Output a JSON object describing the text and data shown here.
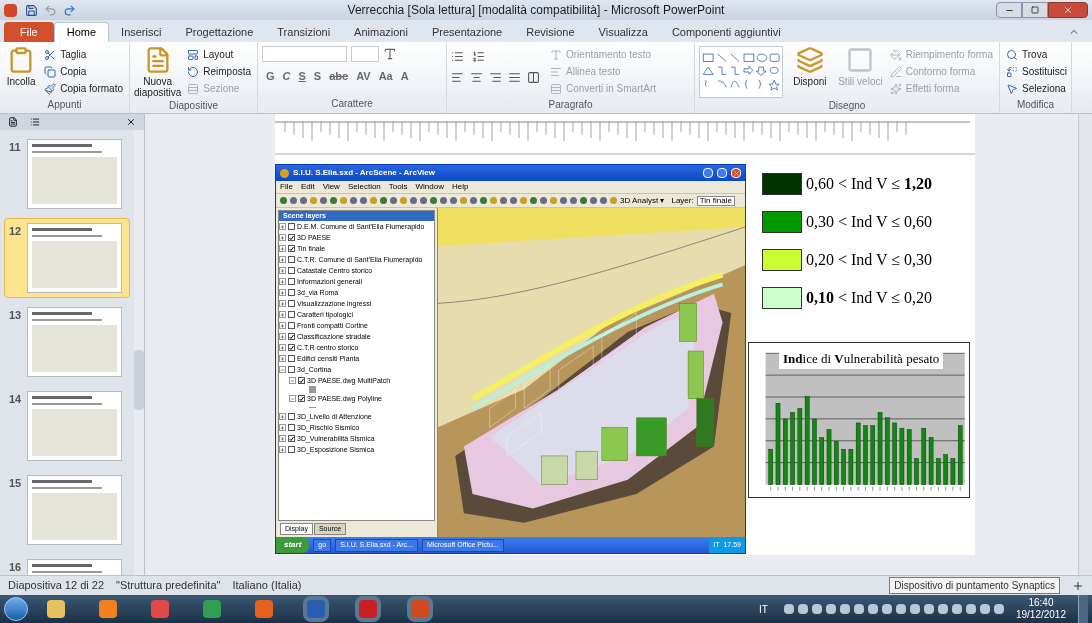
{
  "window": {
    "title": "Verrecchia [Sola lettura] [modalità compatibilità]  -  Microsoft PowerPoint"
  },
  "ribbon_tabs": [
    {
      "label": "File",
      "kind": "file",
      "selected": false
    },
    {
      "label": "Home",
      "kind": "tab",
      "selected": true
    },
    {
      "label": "Inserisci",
      "kind": "tab",
      "selected": false
    },
    {
      "label": "Progettazione",
      "kind": "tab",
      "selected": false
    },
    {
      "label": "Transizioni",
      "kind": "tab",
      "selected": false
    },
    {
      "label": "Animazioni",
      "kind": "tab",
      "selected": false
    },
    {
      "label": "Presentazione",
      "kind": "tab",
      "selected": false
    },
    {
      "label": "Revisione",
      "kind": "tab",
      "selected": false
    },
    {
      "label": "Visualizza",
      "kind": "tab",
      "selected": false
    },
    {
      "label": "Componenti aggiuntivi",
      "kind": "tab",
      "selected": false
    }
  ],
  "ribbon_groups": [
    {
      "label": "Appunti",
      "kind": "standard",
      "large": [
        {
          "label": "Incolla",
          "disabled": false
        }
      ],
      "small": [
        {
          "label": "Taglia",
          "disabled": false
        },
        {
          "label": "Copia",
          "disabled": false
        },
        {
          "label": "Copia formato",
          "disabled": false
        }
      ]
    },
    {
      "label": "Diapositive",
      "kind": "standard",
      "large": [
        {
          "label": "Nuova diapositiva",
          "disabled": false
        }
      ],
      "small": [
        {
          "label": "Layout",
          "disabled": false
        },
        {
          "label": "Reimposta",
          "disabled": false
        },
        {
          "label": "Sezione",
          "disabled": true
        }
      ]
    },
    {
      "label": "Carattere",
      "kind": "font",
      "buttons": [
        "G",
        "C",
        "S",
        "S",
        "abc",
        "AV",
        "Aa",
        "A"
      ]
    },
    {
      "label": "Paragrafo",
      "kind": "paragraph",
      "small": [
        {
          "label": "Orientamento testo",
          "disabled": true
        },
        {
          "label": "Allinea testo",
          "disabled": true
        },
        {
          "label": "Converti in SmartArt",
          "disabled": true
        }
      ]
    },
    {
      "label": "Disegno",
      "kind": "drawing",
      "large": [
        {
          "label": "Disponi",
          "disabled": false
        },
        {
          "label": "Stili veloci",
          "disabled": true
        }
      ],
      "small": [
        {
          "label": "Riempimento forma",
          "disabled": true
        },
        {
          "label": "Contorno forma",
          "disabled": true
        },
        {
          "label": "Effetti forma",
          "disabled": true
        }
      ]
    },
    {
      "label": "Modifica",
      "kind": "standard",
      "small": [
        {
          "label": "Trova",
          "disabled": false
        },
        {
          "label": "Sostituisci",
          "disabled": false
        },
        {
          "label": "Seleziona",
          "disabled": false
        }
      ]
    }
  ],
  "thumbnails": [
    {
      "number": "11",
      "selected": false
    },
    {
      "number": "12",
      "selected": true
    },
    {
      "number": "13",
      "selected": false
    },
    {
      "number": "14",
      "selected": false
    },
    {
      "number": "15",
      "selected": false
    },
    {
      "number": "16",
      "selected": false
    }
  ],
  "arcscene": {
    "title": "S.I.U. S.Elia.sxd - ArcScene - ArcView",
    "menus": [
      "File",
      "Edit",
      "View",
      "Selection",
      "Tools",
      "Window",
      "Help"
    ],
    "analyst": "3D Analyst ▾",
    "layer_label": "Layer:",
    "layer_value": "Tin finale",
    "toc_title": "Scene layers",
    "layers": [
      {
        "label": "D.E.M. Comune di Sant'Elia Fiumerapido",
        "checked": false,
        "expanded": false
      },
      {
        "label": "3D PAESE",
        "checked": true,
        "expanded": false
      },
      {
        "label": "Tin finale",
        "checked": true,
        "expanded": false
      },
      {
        "label": "C.T.R. Comune di Sant'Elia Fiumerapido",
        "checked": false,
        "expanded": false
      },
      {
        "label": "Catastale Centro storico",
        "checked": false,
        "expanded": false
      },
      {
        "label": "Informazioni generali",
        "checked": false,
        "expanded": false
      },
      {
        "label": "3d_via Roma",
        "checked": false,
        "expanded": false
      },
      {
        "label": "Visualizzazione ingressi",
        "checked": false,
        "expanded": false
      },
      {
        "label": "Caratteri tipologici",
        "checked": false,
        "expanded": false
      },
      {
        "label": "Fronti compatti Cortine",
        "checked": false,
        "expanded": false
      },
      {
        "label": "Classificazione stradale",
        "checked": true,
        "expanded": false
      },
      {
        "label": "C.T.R centro storico",
        "checked": true,
        "expanded": false
      },
      {
        "label": "Edifici censiti Pianta",
        "checked": false,
        "expanded": false
      },
      {
        "label": "3d_Cortina",
        "checked": false,
        "expanded": true,
        "children": [
          {
            "label": "3D PAESE.dwg MultiPatch",
            "checked": true,
            "expanded": true
          },
          {
            "label": "3D PAESE.dwg Polyline",
            "checked": true,
            "expanded": true
          }
        ]
      },
      {
        "label": "3D_Livello di Attenzione",
        "checked": false,
        "expanded": false
      },
      {
        "label": "3D_Rischio Sismico",
        "checked": false,
        "expanded": false
      },
      {
        "label": "3D_Vulnerabilità Sismica",
        "checked": true,
        "expanded": false
      },
      {
        "label": "3D_Esposizione Sismica",
        "checked": false,
        "expanded": false
      }
    ],
    "toc_tabs": [
      {
        "label": "Display",
        "selected": true
      },
      {
        "label": "Source",
        "selected": false
      }
    ],
    "taskbar": {
      "start": "start",
      "buttons": [
        "go",
        "S.I.U. S.Elia.sxd - Arc...",
        "Microsoft Office Pictu..."
      ],
      "lang": "IT",
      "time": "17.59"
    }
  },
  "legend": [
    {
      "text": "0,60 < Ind V ≤ **1,20**",
      "color": "#003300"
    },
    {
      "text": "0,30 < Ind V ≤ 0,60",
      "color": "#009900"
    },
    {
      "text": "0,20 < Ind  V ≤ 0,30",
      "color": "#ccff33"
    },
    {
      "text": "**0,10** < Ind V ≤ 0,20",
      "color": "#ccffcc"
    }
  ],
  "chart_title": "**Ind**ice di **V**ulnerabilità pesato",
  "status_bar": {
    "slide": "Diapositiva 12 di 22",
    "theme": "\"Struttura predefinita\"",
    "language": "Italiano (Italia)",
    "tooltip": "Dispositivo di puntamento Synaptics"
  },
  "taskbar": {
    "lang": "IT",
    "time": "16:40",
    "date": "19/12/2012"
  }
}
